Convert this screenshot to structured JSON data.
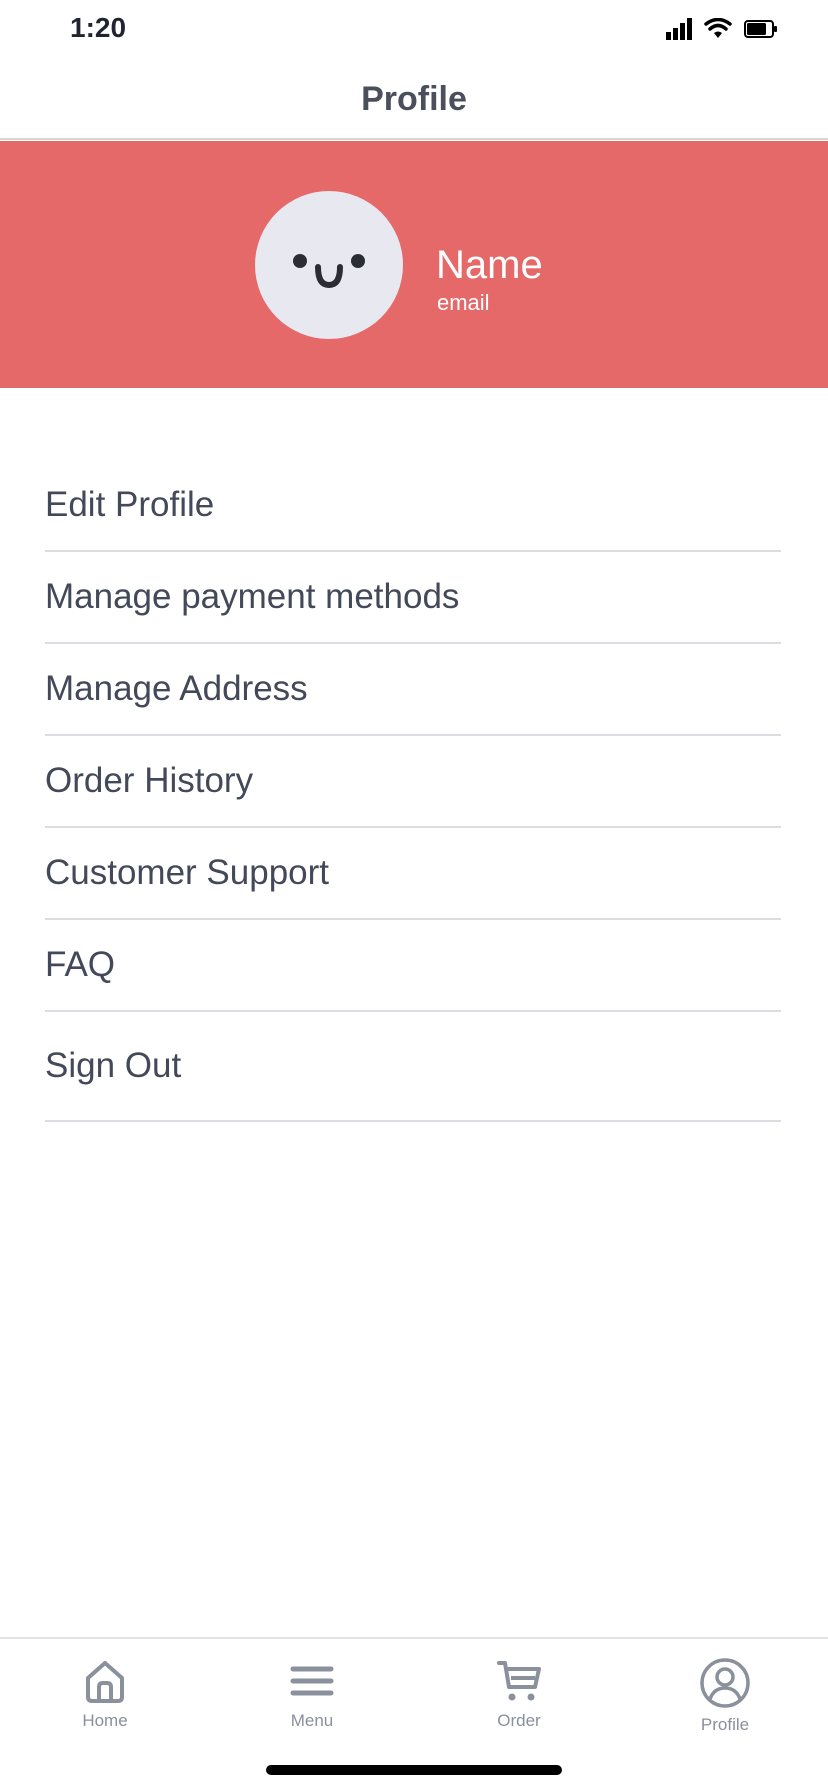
{
  "status_bar": {
    "time": "1:20",
    "icons": [
      "cellular-signal-icon",
      "wifi-icon",
      "battery-icon"
    ]
  },
  "header": {
    "title": "Profile"
  },
  "profile": {
    "avatar_icon": "smiley-face-icon",
    "name": "Name",
    "email": "email",
    "banner_color": "#e56968"
  },
  "menu": {
    "items": [
      {
        "label": "Edit Profile"
      },
      {
        "label": "Manage payment methods"
      },
      {
        "label": "Manage Address"
      },
      {
        "label": "Order History"
      },
      {
        "label": "Customer Support"
      },
      {
        "label": "FAQ"
      },
      {
        "label": "Sign Out"
      }
    ]
  },
  "tab_bar": {
    "tabs": [
      {
        "label": "Home",
        "icon": "home-icon"
      },
      {
        "label": "Menu",
        "icon": "hamburger-menu-icon"
      },
      {
        "label": "Order",
        "icon": "cart-icon"
      },
      {
        "label": "Profile",
        "icon": "user-circle-icon"
      }
    ]
  }
}
